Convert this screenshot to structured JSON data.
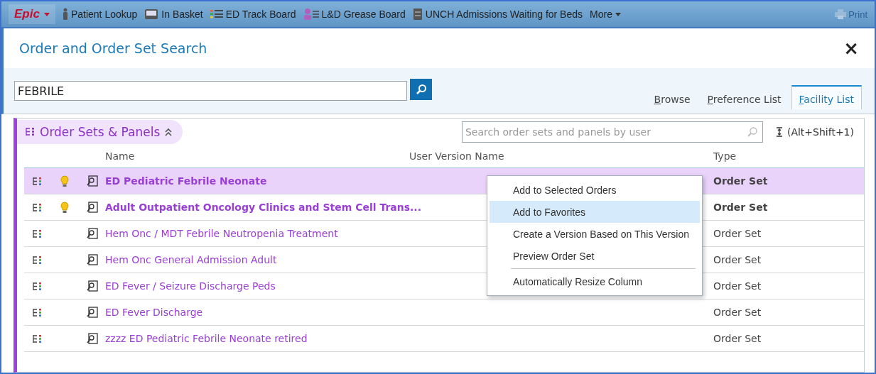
{
  "toolbar": {
    "logo": "Epic",
    "items": [
      {
        "kind": "person",
        "label": "Patient Lookup"
      },
      {
        "kind": "inbox",
        "label": "In Basket"
      },
      {
        "kind": "board",
        "label": "ED Track Board"
      },
      {
        "kind": "grease",
        "label": "L&D Grease Board"
      },
      {
        "kind": "book",
        "label": "UNCH Admissions Waiting for Beds"
      },
      {
        "kind": "more",
        "label": "More"
      }
    ],
    "print": {
      "label": "Print",
      "disabled": true
    }
  },
  "dialog": {
    "title": "Order and Order Set Search",
    "close": "×"
  },
  "search": {
    "value": "FEBRILE"
  },
  "tabs": [
    {
      "label": "Browse",
      "selected": false
    },
    {
      "label": "Preference List",
      "selected": false
    },
    {
      "label": "Facility List",
      "selected": true
    }
  ],
  "panel": {
    "title": "Order Sets & Panels",
    "expanded": true,
    "user_search": {
      "placeholder": "Search order sets and panels by user"
    },
    "shortcut": "(Alt+Shift+1)"
  },
  "table": {
    "columns": [
      "Name",
      "User Version Name",
      "Type"
    ],
    "rows": [
      {
        "name": "ED Pediatric Febrile Neonate",
        "type": "Order Set",
        "selected": true,
        "bold": true,
        "tip": true
      },
      {
        "name": "Adult Outpatient Oncology Clinics and Stem Cell Trans...",
        "type": "Order Set",
        "selected": false,
        "bold": true,
        "tip": true
      },
      {
        "name": "Hem Onc / MDT Febrile Neutropenia Treatment",
        "type": "Order Set",
        "selected": false,
        "bold": false,
        "tip": false
      },
      {
        "name": "Hem Onc General Admission Adult",
        "type": "Order Set",
        "selected": false,
        "bold": false,
        "tip": false
      },
      {
        "name": "ED Fever / Seizure Discharge Peds",
        "type": "Order Set",
        "selected": false,
        "bold": false,
        "tip": false
      },
      {
        "name": "ED Fever Discharge",
        "type": "Order Set",
        "selected": false,
        "bold": false,
        "tip": false
      },
      {
        "name": "zzzz ED Pediatric Febrile Neonate retired",
        "type": "Order Set",
        "selected": false,
        "bold": false,
        "tip": false
      }
    ]
  },
  "context_menu": {
    "items": [
      {
        "label": "Add to Selected Orders",
        "selected": false,
        "separator_before": false
      },
      {
        "label": "Add to Favorites",
        "selected": true,
        "separator_before": false
      },
      {
        "label": "Create a Version Based on This Version",
        "selected": false,
        "separator_before": false
      },
      {
        "label": "Preview Order Set",
        "selected": false,
        "separator_before": false
      },
      {
        "label": "Automatically Resize Column",
        "selected": false,
        "separator_before": true
      }
    ]
  }
}
